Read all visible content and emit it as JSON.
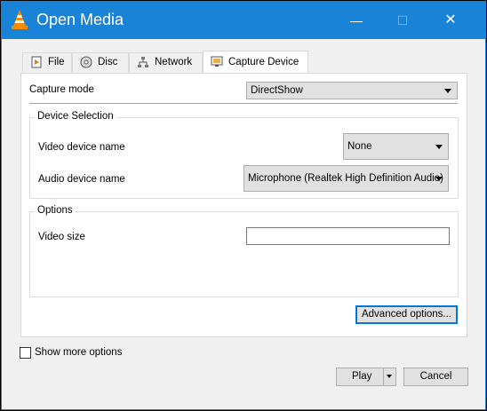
{
  "window": {
    "title": "Open Media",
    "minimize": "—",
    "maximize": "☐",
    "close": "✕"
  },
  "tabs": [
    {
      "label": "File",
      "icon": "file-icon"
    },
    {
      "label": "Disc",
      "icon": "disc-icon"
    },
    {
      "label": "Network",
      "icon": "network-icon"
    },
    {
      "label": "Capture Device",
      "icon": "capture-device-icon",
      "active": true
    }
  ],
  "capture": {
    "mode_label": "Capture mode",
    "mode_value": "DirectShow"
  },
  "device_selection": {
    "title": "Device Selection",
    "video_label": "Video device name",
    "video_value": "None",
    "audio_label": "Audio device name",
    "audio_value": "Microphone (Realtek High Definition Audio)"
  },
  "options": {
    "title": "Options",
    "video_size_label": "Video size",
    "video_size_value": ""
  },
  "advanced_label": "Advanced options...",
  "show_more_label": "Show more options",
  "show_more_checked": false,
  "play_label": "Play",
  "cancel_label": "Cancel",
  "colors": {
    "titlebar": "#1883d7",
    "focus": "#0078d7",
    "background": "#f0f0f0"
  }
}
